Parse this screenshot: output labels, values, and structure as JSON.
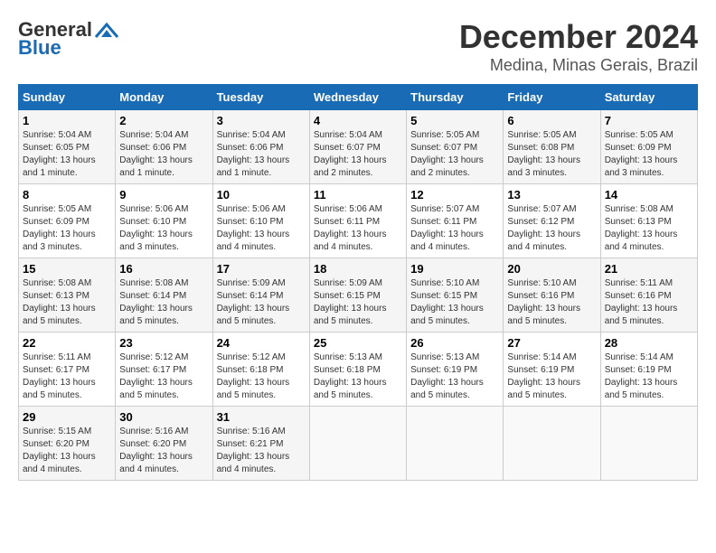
{
  "header": {
    "logo_general": "General",
    "logo_blue": "Blue",
    "month_title": "December 2024",
    "location": "Medina, Minas Gerais, Brazil"
  },
  "days_of_week": [
    "Sunday",
    "Monday",
    "Tuesday",
    "Wednesday",
    "Thursday",
    "Friday",
    "Saturday"
  ],
  "weeks": [
    [
      {
        "day": "1",
        "sunrise": "5:04 AM",
        "sunset": "6:05 PM",
        "daylight": "13 hours and 1 minute."
      },
      {
        "day": "2",
        "sunrise": "5:04 AM",
        "sunset": "6:06 PM",
        "daylight": "13 hours and 1 minute."
      },
      {
        "day": "3",
        "sunrise": "5:04 AM",
        "sunset": "6:06 PM",
        "daylight": "13 hours and 1 minute."
      },
      {
        "day": "4",
        "sunrise": "5:04 AM",
        "sunset": "6:07 PM",
        "daylight": "13 hours and 2 minutes."
      },
      {
        "day": "5",
        "sunrise": "5:05 AM",
        "sunset": "6:07 PM",
        "daylight": "13 hours and 2 minutes."
      },
      {
        "day": "6",
        "sunrise": "5:05 AM",
        "sunset": "6:08 PM",
        "daylight": "13 hours and 3 minutes."
      },
      {
        "day": "7",
        "sunrise": "5:05 AM",
        "sunset": "6:09 PM",
        "daylight": "13 hours and 3 minutes."
      }
    ],
    [
      {
        "day": "8",
        "sunrise": "5:05 AM",
        "sunset": "6:09 PM",
        "daylight": "13 hours and 3 minutes."
      },
      {
        "day": "9",
        "sunrise": "5:06 AM",
        "sunset": "6:10 PM",
        "daylight": "13 hours and 3 minutes."
      },
      {
        "day": "10",
        "sunrise": "5:06 AM",
        "sunset": "6:10 PM",
        "daylight": "13 hours and 4 minutes."
      },
      {
        "day": "11",
        "sunrise": "5:06 AM",
        "sunset": "6:11 PM",
        "daylight": "13 hours and 4 minutes."
      },
      {
        "day": "12",
        "sunrise": "5:07 AM",
        "sunset": "6:11 PM",
        "daylight": "13 hours and 4 minutes."
      },
      {
        "day": "13",
        "sunrise": "5:07 AM",
        "sunset": "6:12 PM",
        "daylight": "13 hours and 4 minutes."
      },
      {
        "day": "14",
        "sunrise": "5:08 AM",
        "sunset": "6:13 PM",
        "daylight": "13 hours and 4 minutes."
      }
    ],
    [
      {
        "day": "15",
        "sunrise": "5:08 AM",
        "sunset": "6:13 PM",
        "daylight": "13 hours and 5 minutes."
      },
      {
        "day": "16",
        "sunrise": "5:08 AM",
        "sunset": "6:14 PM",
        "daylight": "13 hours and 5 minutes."
      },
      {
        "day": "17",
        "sunrise": "5:09 AM",
        "sunset": "6:14 PM",
        "daylight": "13 hours and 5 minutes."
      },
      {
        "day": "18",
        "sunrise": "5:09 AM",
        "sunset": "6:15 PM",
        "daylight": "13 hours and 5 minutes."
      },
      {
        "day": "19",
        "sunrise": "5:10 AM",
        "sunset": "6:15 PM",
        "daylight": "13 hours and 5 minutes."
      },
      {
        "day": "20",
        "sunrise": "5:10 AM",
        "sunset": "6:16 PM",
        "daylight": "13 hours and 5 minutes."
      },
      {
        "day": "21",
        "sunrise": "5:11 AM",
        "sunset": "6:16 PM",
        "daylight": "13 hours and 5 minutes."
      }
    ],
    [
      {
        "day": "22",
        "sunrise": "5:11 AM",
        "sunset": "6:17 PM",
        "daylight": "13 hours and 5 minutes."
      },
      {
        "day": "23",
        "sunrise": "5:12 AM",
        "sunset": "6:17 PM",
        "daylight": "13 hours and 5 minutes."
      },
      {
        "day": "24",
        "sunrise": "5:12 AM",
        "sunset": "6:18 PM",
        "daylight": "13 hours and 5 minutes."
      },
      {
        "day": "25",
        "sunrise": "5:13 AM",
        "sunset": "6:18 PM",
        "daylight": "13 hours and 5 minutes."
      },
      {
        "day": "26",
        "sunrise": "5:13 AM",
        "sunset": "6:19 PM",
        "daylight": "13 hours and 5 minutes."
      },
      {
        "day": "27",
        "sunrise": "5:14 AM",
        "sunset": "6:19 PM",
        "daylight": "13 hours and 5 minutes."
      },
      {
        "day": "28",
        "sunrise": "5:14 AM",
        "sunset": "6:19 PM",
        "daylight": "13 hours and 5 minutes."
      }
    ],
    [
      {
        "day": "29",
        "sunrise": "5:15 AM",
        "sunset": "6:20 PM",
        "daylight": "13 hours and 4 minutes."
      },
      {
        "day": "30",
        "sunrise": "5:16 AM",
        "sunset": "6:20 PM",
        "daylight": "13 hours and 4 minutes."
      },
      {
        "day": "31",
        "sunrise": "5:16 AM",
        "sunset": "6:21 PM",
        "daylight": "13 hours and 4 minutes."
      },
      null,
      null,
      null,
      null
    ]
  ]
}
